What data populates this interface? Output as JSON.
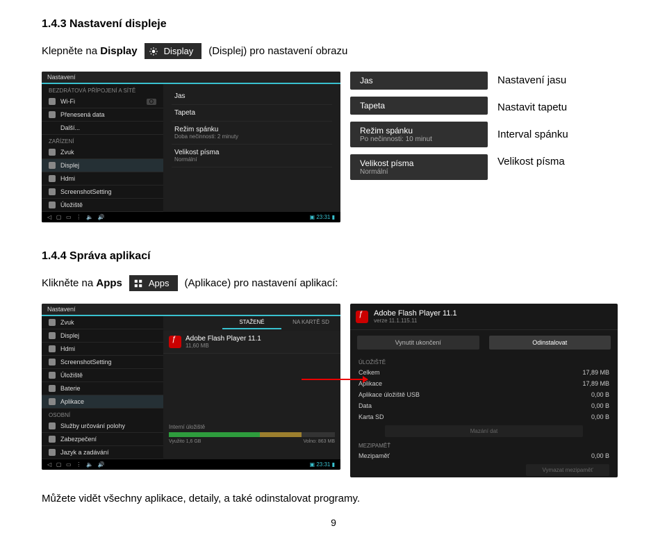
{
  "sec1": {
    "title": "1.4.3 Nastavení displeje",
    "intro1": "Klepněte na ",
    "intro_bold": "Display",
    "chip": "Display",
    "intro2": "(Displej) pro nastavení obrazu"
  },
  "shot1": {
    "topbar": "Nastavení",
    "cat1": "BEZDRÁTOVÁ PŘÍPOJENÍ A SÍTĚ",
    "wifi": "Wi-Fi",
    "wifi_toggle": "O",
    "data": "Přenesená data",
    "more": "Další...",
    "cat2": "ZAŘÍZENÍ",
    "zvuk": "Zvuk",
    "displej": "Displej",
    "hdmi": "Hdmi",
    "scr": "ScreenshotSetting",
    "ulo": "Úložiště",
    "right_jas": "Jas",
    "right_tap": "Tapeta",
    "right_rez": "Režim spánku",
    "right_rez_sub": "Doba nečinnosti: 2 minuty",
    "right_vel": "Velikost písma",
    "right_vel_sub": "Normální",
    "time": "23:31"
  },
  "pop": {
    "jas": "Jas",
    "tap": "Tapeta",
    "rez": "Režim spánku",
    "rez_sub": "Po nečinnosti: 10 minut",
    "vel": "Velikost písma",
    "vel_sub": "Normální"
  },
  "labels": {
    "l1": "Nastavení jasu",
    "l2": "Nastavit tapetu",
    "l3": "Interval spánku",
    "l4": "Velikost písma"
  },
  "sec2": {
    "title": "1.4.4 Správa aplikací",
    "intro1": "Klikněte na ",
    "intro_bold": "Apps",
    "chip": "Apps",
    "intro2": "(Aplikace) pro nastavení aplikací:"
  },
  "shot3": {
    "topbar": "Nastavení",
    "zvuk": "Zvuk",
    "displej": "Displej",
    "hdmi": "Hdmi",
    "scr": "ScreenshotSetting",
    "ulo": "Úložiště",
    "bat": "Baterie",
    "apl": "Aplikace",
    "cat3": "OSOBNÍ",
    "loc": "Služby určování polohy",
    "zab": "Zabezpečení",
    "jaz": "Jazyk a zadávání",
    "tab_left": "",
    "tab_mid": "STAŽENÉ",
    "tab_right": "NA KARTĚ SD",
    "app_name": "Adobe Flash Player 11.1",
    "app_size": "11,60 MB",
    "stor_label": "Interní úložiště",
    "stor_used": "Využito 1,6 GB",
    "stor_free": "Volno: 863 MB",
    "time": "23:31"
  },
  "shot5": {
    "app": "Adobe Flash Player 11.1",
    "ver": "verze 11.1.115.11",
    "btn1": "Vynutit ukončení",
    "btn2": "Odinstalovat",
    "cat_ulo": "ÚLOŽIŠTĚ",
    "k_cel": "Celkem",
    "v_cel": "17,89 MB",
    "k_apl": "Aplikace",
    "v_apl": "17,89 MB",
    "k_usb": "Aplikace úložiště USB",
    "v_usb": "0,00 B",
    "k_dat": "Data",
    "v_dat": "0,00 B",
    "k_sd": "Karta SD",
    "v_sd": "0,00 B",
    "btn_smaz": "Mazání dat",
    "cat_mez": "MEZIPAMĚŤ",
    "k_mez": "Mezipaměť",
    "v_mez": "0,00 B",
    "btn_mez": "Vymazat mezipaměť"
  },
  "footer": "Můžete vidět všechny aplikace, detaily, a také odinstalovat programy.",
  "page_no": "9"
}
